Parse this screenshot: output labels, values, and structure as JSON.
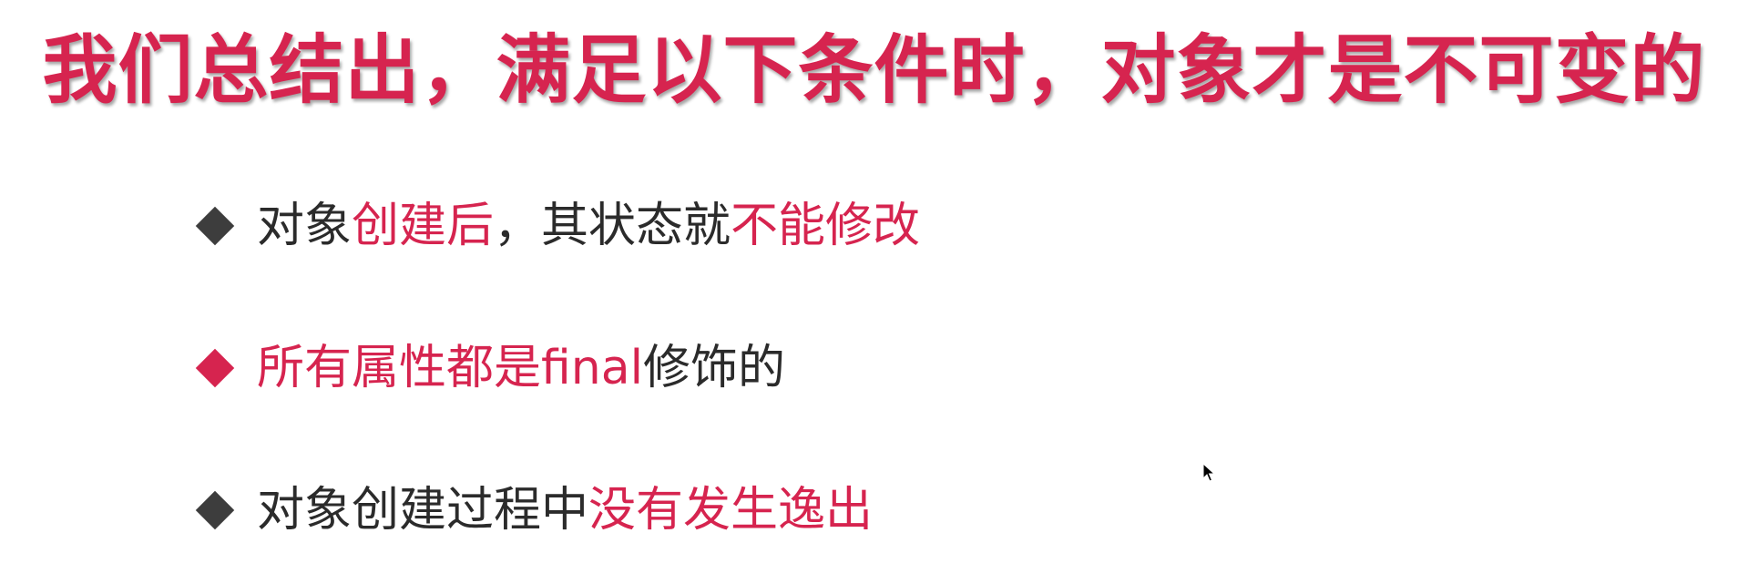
{
  "colors": {
    "accent": "#d6244f",
    "text": "#2b2b2b",
    "bullet_dark": "#3d3d3d",
    "background": "#ffffff"
  },
  "title": "我们总结出，满足以下条件时，对象才是不可变的",
  "bullets": [
    {
      "icon": "diamond-bullet-icon",
      "segments": [
        {
          "text": "对象",
          "style": "normal"
        },
        {
          "text": "创建后",
          "style": "accent"
        },
        {
          "text": "，其状态就",
          "style": "normal"
        },
        {
          "text": "不能修改",
          "style": "accent"
        }
      ]
    },
    {
      "icon": "diamond-bullet-icon",
      "segments": [
        {
          "text": "所有属性都是final",
          "style": "accent"
        },
        {
          "text": "修饰的",
          "style": "normal"
        }
      ]
    },
    {
      "icon": "diamond-bullet-icon",
      "segments": [
        {
          "text": "对象创建过程中",
          "style": "normal"
        },
        {
          "text": "没有发生逸出",
          "style": "accent"
        }
      ]
    }
  ]
}
